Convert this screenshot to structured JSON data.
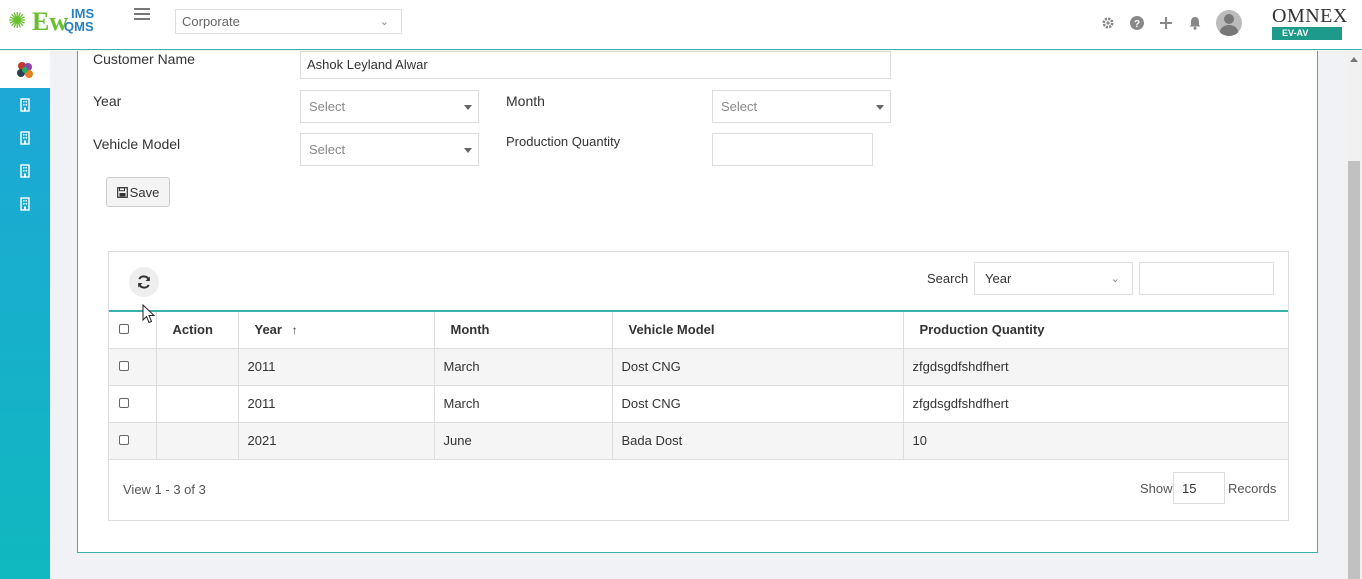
{
  "header": {
    "logo_main": "Ew",
    "logo_top": "IMS",
    "logo_bottom": "QMS",
    "org_select": "Corporate",
    "brand": "OMNEX",
    "brand_sub": "EV-AV",
    "icons": [
      "gear-icon",
      "help-icon",
      "plus-icon",
      "bell-icon",
      "user-avatar"
    ]
  },
  "sidebar": {
    "items": [
      "building-icon",
      "building-icon",
      "building-icon",
      "building-icon"
    ]
  },
  "form": {
    "customer_name_label": "Customer Name",
    "customer_name_value": "Ashok Leyland Alwar",
    "year_label": "Year",
    "year_value": "Select",
    "month_label": "Month",
    "month_value": "Select",
    "vehicle_model_label": "Vehicle Model",
    "vehicle_model_value": "Select",
    "production_quantity_label": "Production Quantity",
    "production_quantity_value": "",
    "save_label": "Save"
  },
  "grid": {
    "search_label": "Search",
    "search_field": "Year",
    "search_value": "",
    "columns": [
      "Action",
      "Year",
      "Month",
      "Vehicle Model",
      "Production Quantity"
    ],
    "sort_column": "Year",
    "sort_direction": "ascending",
    "rows": [
      {
        "action": "",
        "year": "2011",
        "month": "March",
        "vehicle_model": "Dost CNG",
        "production_quantity": "zfgdsgdfshdfhert"
      },
      {
        "action": "",
        "year": "2011",
        "month": "March",
        "vehicle_model": "Dost CNG",
        "production_quantity": "zfgdsgdfshdfhert"
      },
      {
        "action": "",
        "year": "2021",
        "month": "June",
        "vehicle_model": "Bada Dost",
        "production_quantity": "10"
      }
    ],
    "view_text": "View 1 - 3 of 3",
    "show_label": "Show",
    "records_per_page": "15",
    "records_label": "Records"
  },
  "colors": {
    "accent": "#38b2ac",
    "sidebar_top": "#1ea7d8",
    "sidebar_bottom": "#10b8bf",
    "logo_green": "#6abf2e",
    "logo_blue": "#2a7fc1",
    "brand_badge": "#1d9a8a"
  }
}
